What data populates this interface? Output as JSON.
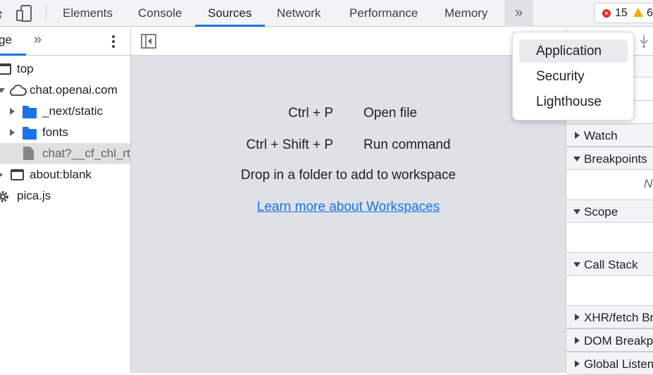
{
  "tabs": [
    {
      "label": "Elements"
    },
    {
      "label": "Console"
    },
    {
      "label": "Sources"
    },
    {
      "label": "Network"
    },
    {
      "label": "Performance"
    },
    {
      "label": "Memory"
    }
  ],
  "active_tab": "Sources",
  "more_tabs_glyph": "»",
  "issues": {
    "errors": "15",
    "warnings": "6",
    "error_color": "#d93025",
    "warning_color": "#f9ab00"
  },
  "navigator": {
    "tab_label": "ge",
    "more_glyph": "»",
    "tree": [
      {
        "label": "top"
      },
      {
        "label": "chat.openai.com"
      },
      {
        "label": "_next/static"
      },
      {
        "label": "fonts"
      },
      {
        "label": "chat?__cf_chl_rt_"
      },
      {
        "label": "about:blank"
      },
      {
        "label": "pica.js"
      }
    ]
  },
  "editor": {
    "shortcuts": [
      {
        "keys": "Ctrl + P",
        "action": "Open file"
      },
      {
        "keys": "Ctrl + Shift + P",
        "action": "Run command"
      }
    ],
    "drop_text": "Drop in a folder to add to workspace",
    "learn_link": "Learn more about Workspaces"
  },
  "debugger": {
    "sections": [
      {
        "label": "Watch",
        "expanded": false
      },
      {
        "label": "Breakpoints",
        "expanded": true
      },
      {
        "label": "Scope",
        "expanded": true
      },
      {
        "label": "Call Stack",
        "expanded": true
      },
      {
        "label": "XHR/fetch Breakpoints",
        "expanded": false
      },
      {
        "label": "DOM Breakpoints",
        "expanded": false
      },
      {
        "label": "Global Listeners",
        "expanded": false
      }
    ],
    "breakpoints_placeholder": "N"
  },
  "dropdown_menu": {
    "items": [
      {
        "label": "Application"
      },
      {
        "label": "Security"
      },
      {
        "label": "Lighthouse"
      }
    ],
    "highlighted": "Application"
  },
  "colors": {
    "accent": "#1a73e8",
    "editor_bg": "#dee1e6",
    "toolbar_bg": "#f1f3f4"
  }
}
